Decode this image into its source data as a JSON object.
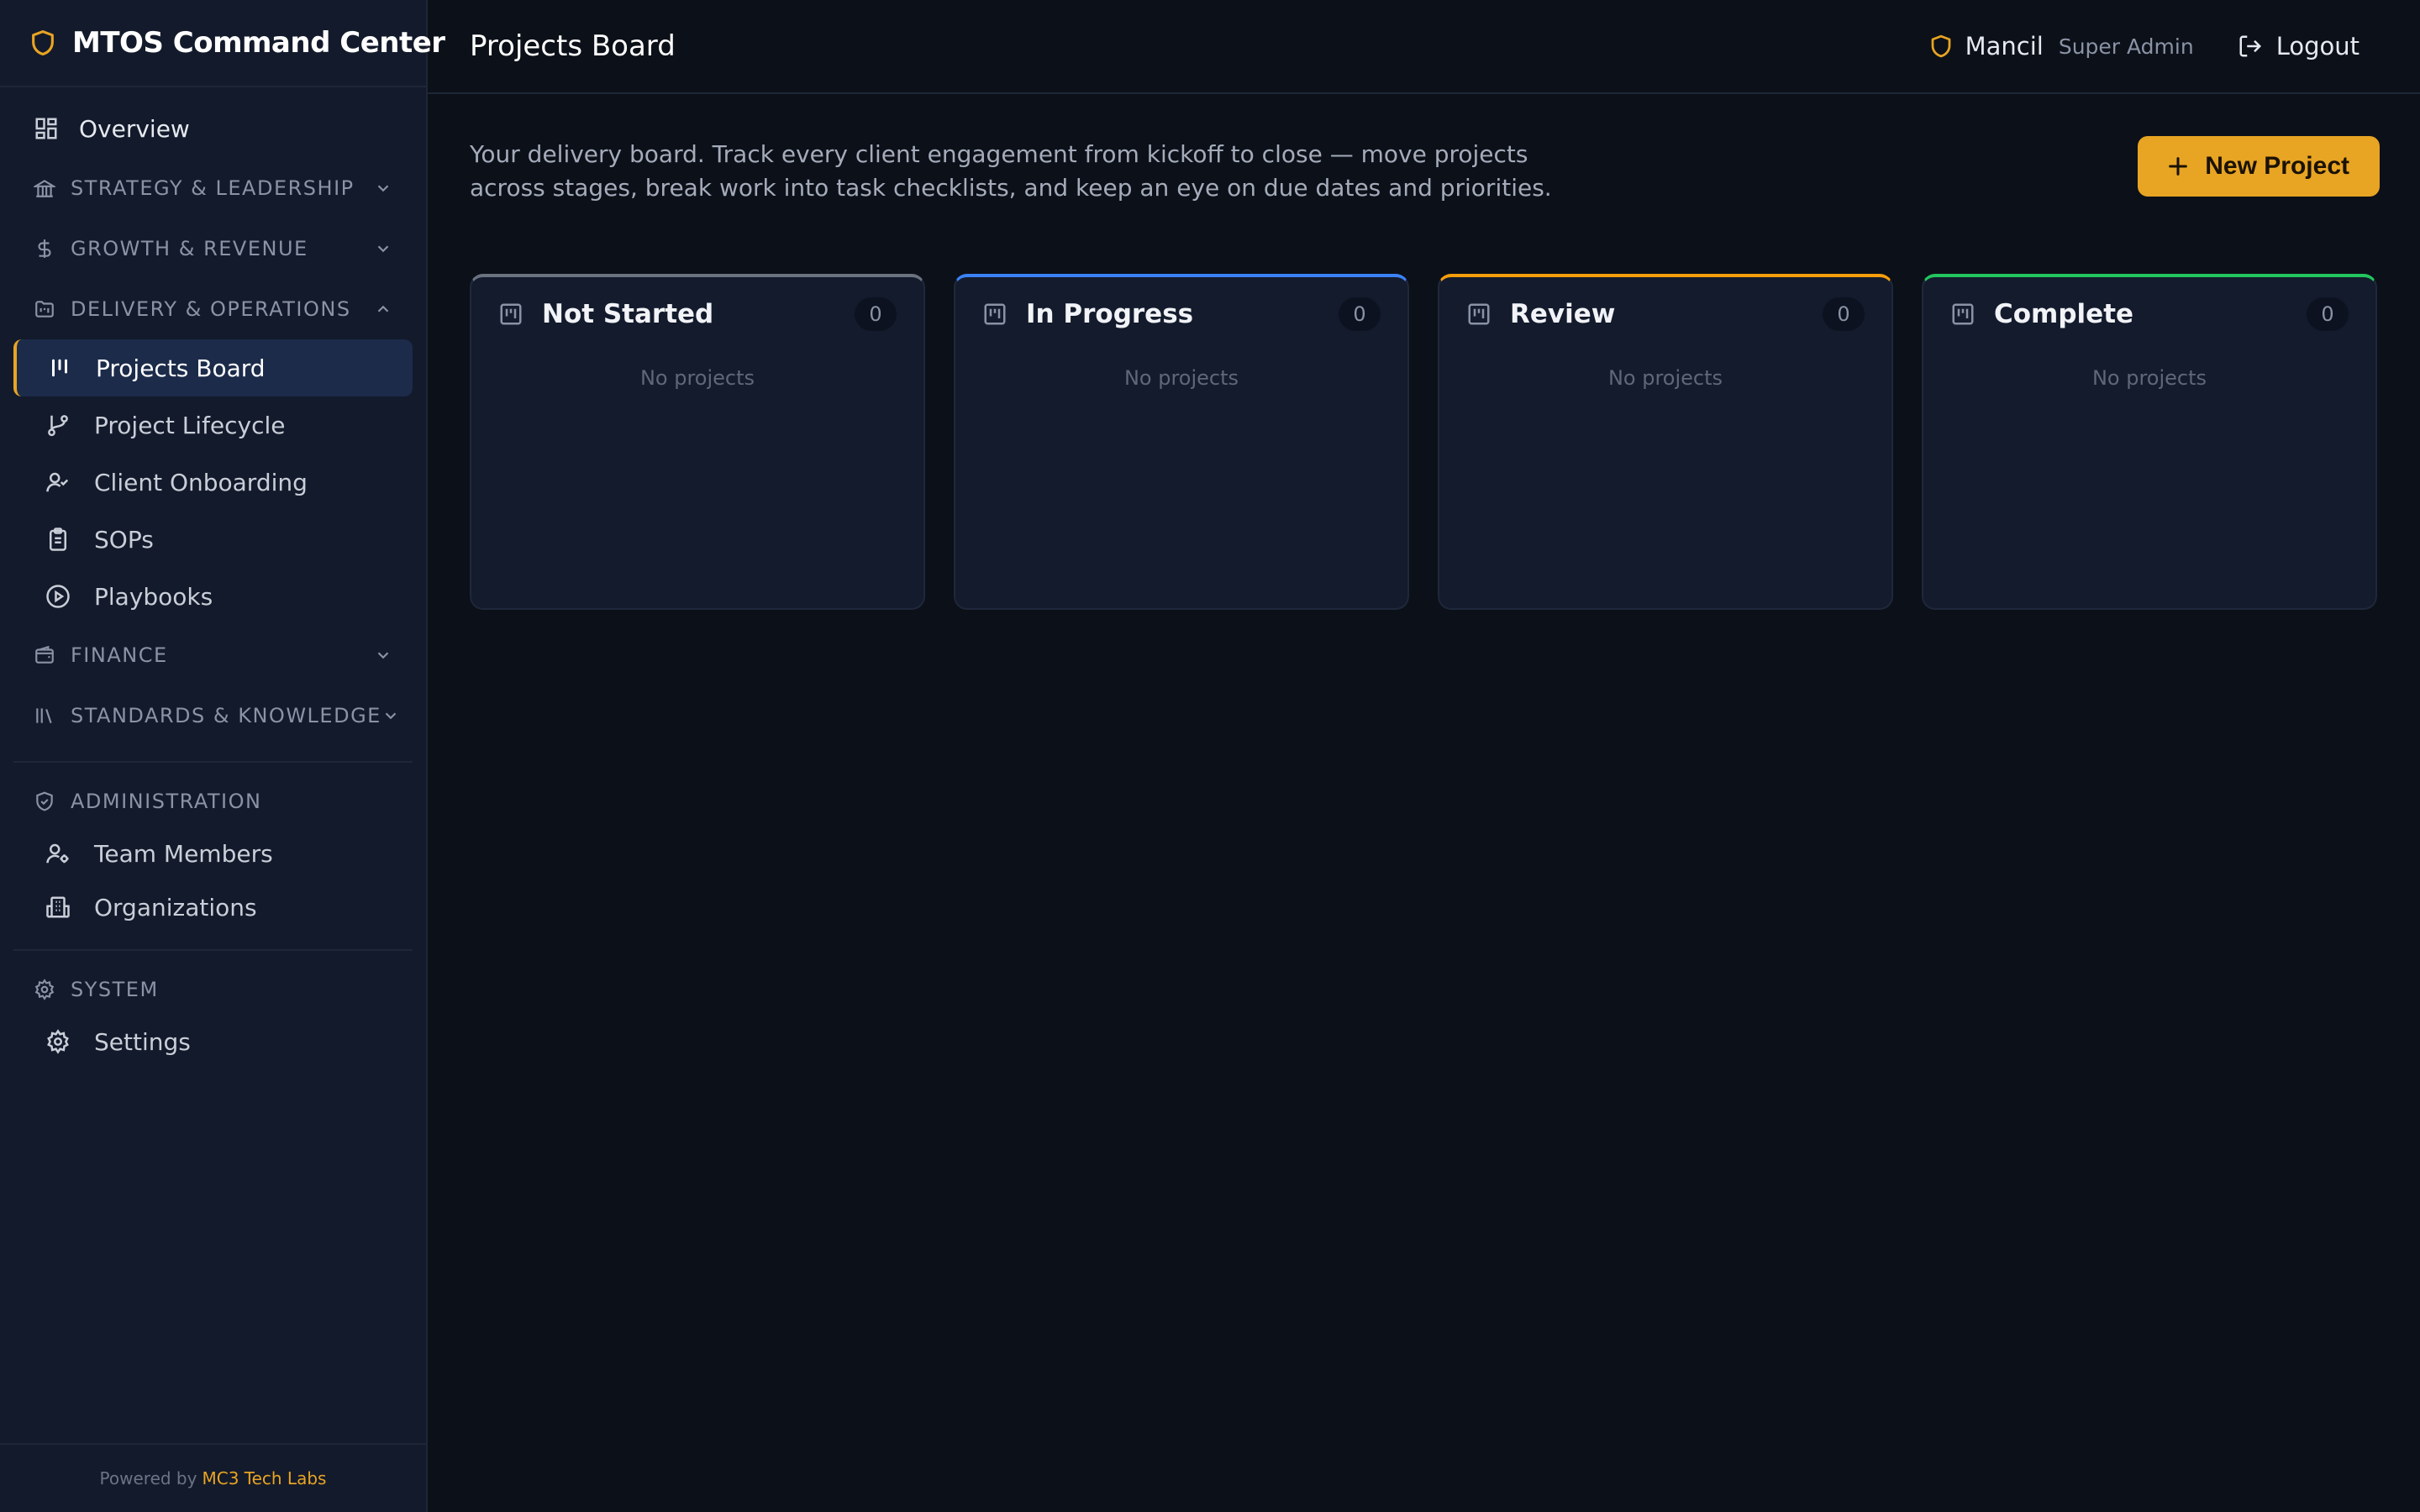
{
  "app": {
    "title": "MTOS Command Center"
  },
  "nav": {
    "overview": "Overview",
    "sections": {
      "strategy": "STRATEGY & LEADERSHIP",
      "growth": "GROWTH & REVENUE",
      "delivery": "DELIVERY & OPERATIONS",
      "finance": "FINANCE",
      "standards": "STANDARDS & KNOWLEDGE",
      "administration": "ADMINISTRATION",
      "system": "SYSTEM"
    },
    "delivery_items": [
      "Projects Board",
      "Project Lifecycle",
      "Client Onboarding",
      "SOPs",
      "Playbooks"
    ],
    "admin_items": [
      "Team Members",
      "Organizations"
    ],
    "system_items": [
      "Settings"
    ]
  },
  "footer": {
    "prefix": "Powered by",
    "link": "MC3 Tech Labs"
  },
  "header": {
    "title": "Projects Board",
    "user_name": "Mancil",
    "user_role": "Super Admin",
    "logout": "Logout"
  },
  "page": {
    "description": "Your delivery board. Track every client engagement from kickoff to close — move projects across stages, break work into task checklists, and keep an eye on due dates and priorities.",
    "new_button": "New Project"
  },
  "columns": [
    {
      "title": "Not Started",
      "count": "0",
      "empty": "No projects",
      "accent": "#6b7280"
    },
    {
      "title": "In Progress",
      "count": "0",
      "empty": "No projects",
      "accent": "#3b82f6"
    },
    {
      "title": "Review",
      "count": "0",
      "empty": "No projects",
      "accent": "#f59e0b"
    },
    {
      "title": "Complete",
      "count": "0",
      "empty": "No projects",
      "accent": "#22c55e"
    }
  ],
  "colors": {
    "accent": "#e8a423",
    "background": "#0c1018",
    "sidebar": "#131a2b"
  }
}
